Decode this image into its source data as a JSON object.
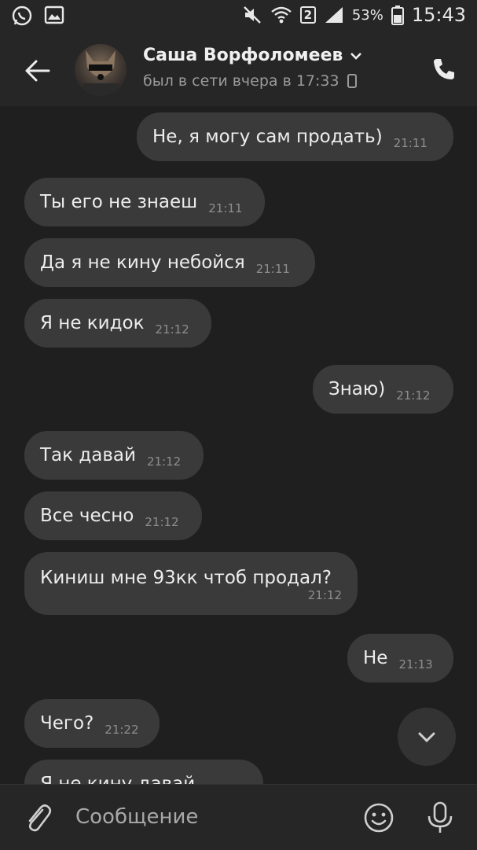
{
  "status_bar": {
    "battery_percent": "53%",
    "sim_slot": "2",
    "time": "15:43"
  },
  "header": {
    "contact_name": "Саша Ворфоломеев",
    "last_seen": "был в сети вчера в 17:33"
  },
  "messages": [
    {
      "text": "Не, я могу сам продать)",
      "time": "21:11",
      "direction": "out"
    },
    {
      "text": "Ты его не знаеш",
      "time": "21:11",
      "direction": "in"
    },
    {
      "text": "Да я не кину небойся",
      "time": "21:11",
      "direction": "in"
    },
    {
      "text": "Я не кидок",
      "time": "21:12",
      "direction": "in"
    },
    {
      "text": "Знаю)",
      "time": "21:12",
      "direction": "out"
    },
    {
      "text": "Так давай",
      "time": "21:12",
      "direction": "in"
    },
    {
      "text": "Все чесно",
      "time": "21:12",
      "direction": "in"
    },
    {
      "text": "Киниш мне 93кк чтоб продал?",
      "time": "21:12",
      "direction": "in"
    },
    {
      "text": "Не",
      "time": "21:13",
      "direction": "out"
    },
    {
      "text": "Чего?",
      "time": "21:22",
      "direction": "in"
    },
    {
      "text": "Я не кину давай",
      "time": "",
      "direction": "in"
    }
  ],
  "composer": {
    "placeholder": "Сообщение"
  },
  "icons": [
    "whatsapp-icon",
    "gallery-icon",
    "mute-icon",
    "wifi-icon",
    "signal-icon",
    "battery-icon",
    "back-arrow-icon",
    "chevron-down-icon",
    "device-icon",
    "phone-icon",
    "paperclip-icon",
    "emoji-icon",
    "mic-icon",
    "scroll-down-icon"
  ]
}
